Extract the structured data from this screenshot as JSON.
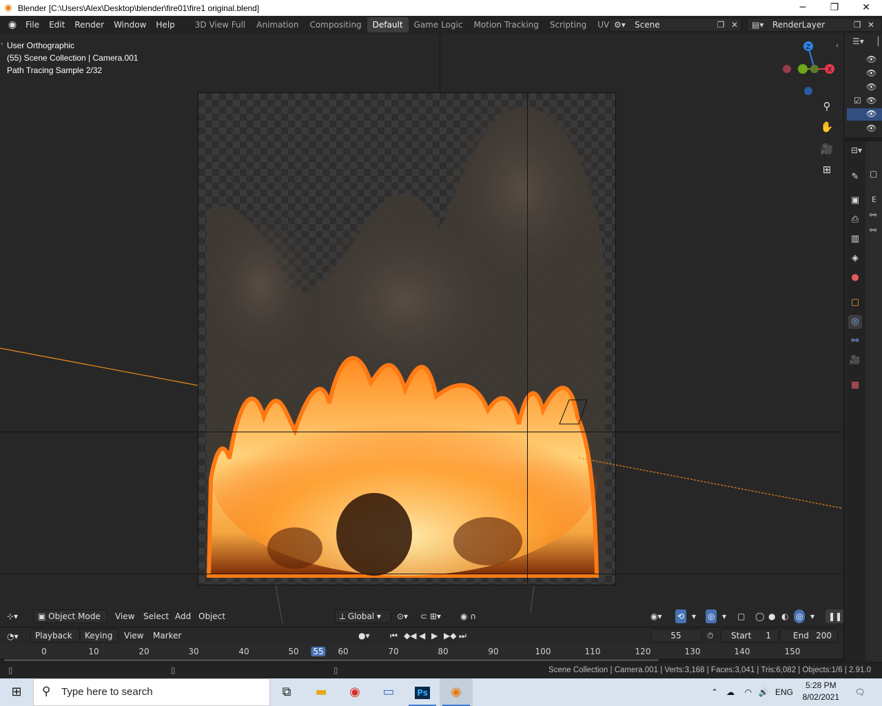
{
  "window": {
    "title": "Blender [C:\\Users\\Alex\\Desktop\\blender\\fire01\\fire1 original.blend]",
    "controls": {
      "minimize": "─",
      "maximize": "❐",
      "close": "✕"
    }
  },
  "topbar": {
    "menus": [
      "File",
      "Edit",
      "Render",
      "Window",
      "Help"
    ],
    "workspaces": [
      "3D View Full",
      "Animation",
      "Compositing",
      "Default",
      "Game Logic",
      "Motion Tracking",
      "Scripting",
      "UV Editing",
      "V"
    ],
    "active_workspace": "Default",
    "scene": "Scene",
    "view_layer": "RenderLayer"
  },
  "viewport": {
    "view_name": "User Orthographic",
    "collection_info": "(55) Scene Collection | Camera.001",
    "render_status": "Path Tracing Sample 2/32",
    "gizmo": {
      "x": "X",
      "y": "Y",
      "z": "Z"
    }
  },
  "viewport_header": {
    "mode": "Object Mode",
    "menus": [
      "View",
      "Select",
      "Add",
      "Object"
    ],
    "orientation": "Global"
  },
  "timeline": {
    "menus": [
      "Playback",
      "Keying",
      "View",
      "Marker"
    ],
    "current_frame": "55",
    "start_label": "Start",
    "start": "1",
    "end_label": "End",
    "end": "200",
    "ticks": [
      "0",
      "10",
      "20",
      "30",
      "40",
      "50",
      "55",
      "60",
      "70",
      "80",
      "90",
      "100",
      "110",
      "120",
      "130",
      "140",
      "150"
    ]
  },
  "statusbar": {
    "info": "Scene Collection | Camera.001 | Verts:3,168 | Faces:3,041 | Tris:6,082 | Objects:1/6 | 2.91.0"
  },
  "taskbar": {
    "search_placeholder": "Type here to search",
    "language": "ENG",
    "time": "5:28 PM",
    "date": "8/02/2021"
  },
  "properties": {
    "tab_letter": "E"
  },
  "colors": {
    "accent_blue": "#4772b3",
    "active_object_orange": "#e87d0d",
    "axis_x": "#e8384f",
    "axis_y": "#6ea719",
    "axis_z": "#2f83e6"
  }
}
